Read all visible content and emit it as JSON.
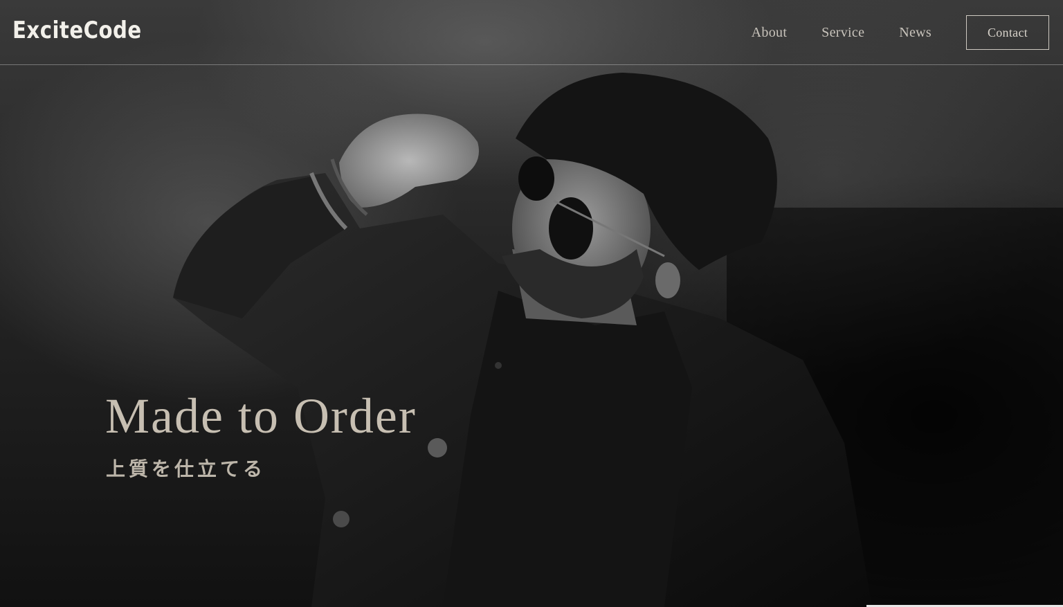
{
  "brand": {
    "logo_text": "ExciteCode"
  },
  "nav": {
    "items": [
      {
        "label": "About"
      },
      {
        "label": "Service"
      },
      {
        "label": "News"
      }
    ],
    "contact_label": "Contact"
  },
  "hero": {
    "headline": "Made to Order",
    "subheadline": "上質を仕立てる",
    "image": "monochrome-portrait-man-sunglasses"
  },
  "colors": {
    "headline": "#c7bfb2",
    "nav_text": "#c9c4bc",
    "background": "#1a1a1a"
  }
}
